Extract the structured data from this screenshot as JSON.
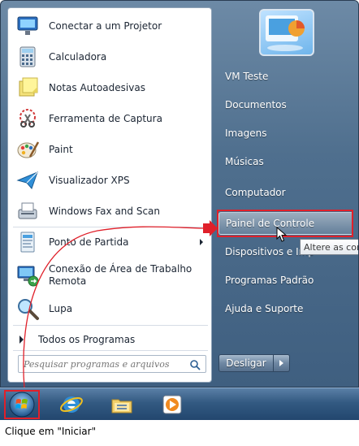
{
  "start_menu": {
    "programs": [
      {
        "label": "Conectar a um Projetor",
        "icon": "projector-icon"
      },
      {
        "label": "Calculadora",
        "icon": "calculator-icon"
      },
      {
        "label": "Notas Autoadesivas",
        "icon": "sticky-notes-icon"
      },
      {
        "label": "Ferramenta de Captura",
        "icon": "snipping-tool-icon"
      },
      {
        "label": "Paint",
        "icon": "paint-icon"
      },
      {
        "label": "Visualizador XPS",
        "icon": "xps-viewer-icon"
      },
      {
        "label": "Windows Fax and Scan",
        "icon": "fax-scan-icon"
      },
      {
        "label": "Ponto de Partida",
        "icon": "getting-started-icon"
      },
      {
        "label": "Conexão de Área de Trabalho Remota",
        "icon": "remote-desktop-icon"
      },
      {
        "label": "Lupa",
        "icon": "magnifier-icon"
      }
    ],
    "all_programs": "Todos os Programas",
    "search": {
      "placeholder": "Pesquisar programas e arquivos",
      "value": ""
    },
    "right_items": [
      {
        "label": "VM Teste"
      },
      {
        "label": "Documentos"
      },
      {
        "label": "Imagens"
      },
      {
        "label": "Músicas"
      },
      {
        "label": "Computador"
      },
      {
        "label": "Painel de Controle"
      },
      {
        "label": "Dispositivos e Imp"
      },
      {
        "label": "Programas Padrão"
      },
      {
        "label": "Ajuda e Suporte"
      }
    ],
    "shutdown_label": "Desligar",
    "tooltip": "Altere as conf"
  },
  "taskbar": {
    "icons": [
      "windows-orb-icon",
      "internet-explorer-icon",
      "windows-explorer-icon",
      "media-player-icon"
    ]
  },
  "caption": "Clique em \"Iniciar\"",
  "colors": {
    "highlight_red": "#e0202a",
    "menu_blue": "#4f6f8e"
  }
}
